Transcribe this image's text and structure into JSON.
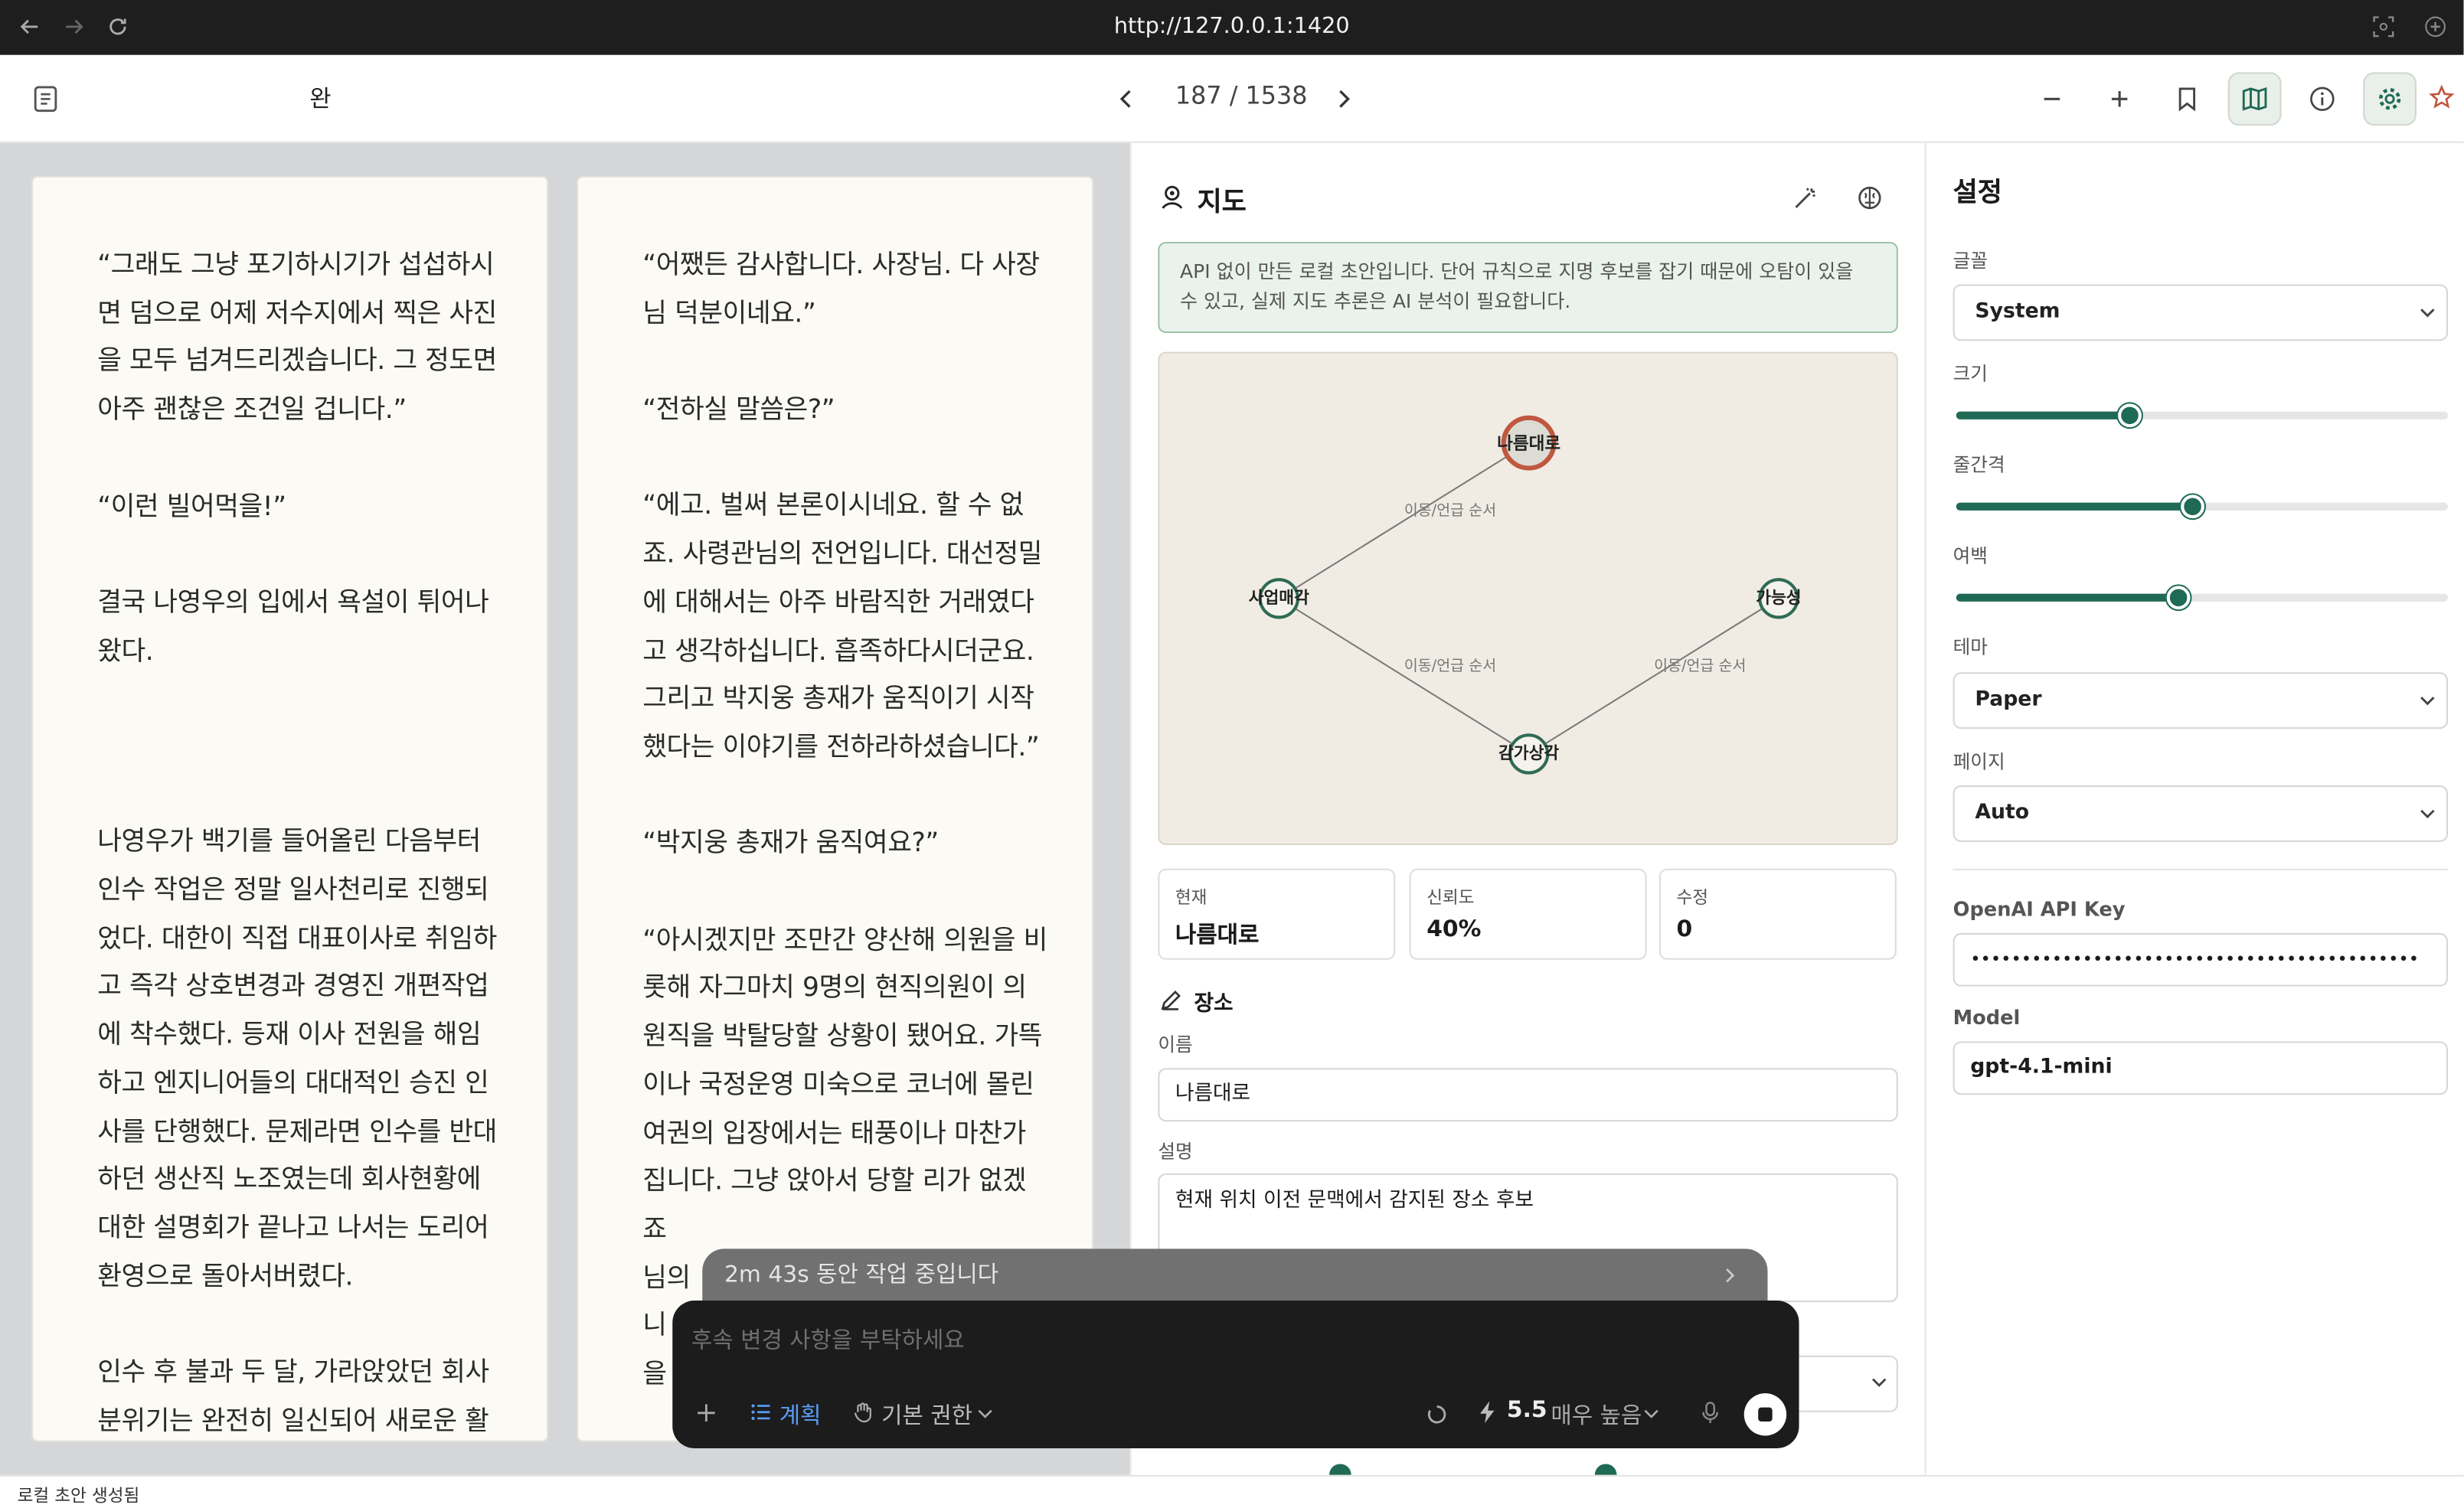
{
  "browser": {
    "url": "http://127.0.0.1:1420"
  },
  "toolbar": {
    "title": "완",
    "page_indicator": "187 / 1538"
  },
  "pages": [
    [
      "“그래도 그냥 포기하시기가 섭섭하시면 덤으로 어제 저수지에서 찍은 사진을 모두 넘겨드리겠습니다. 그 정도면 아주 괜찮은 조건일 겁니다.”",
      "“이런 빌어먹을!”",
      "결국 나영우의 입에서 욕설이 튀어나왔다.",
      "나영우가 백기를 들어올린 다음부터 인수 작업은 정말 일사천리로 진행되었다. 대한이 직접 대표이사로 취임하고 즉각 상호변경과 경영진 개편작업에 착수했다. 등재 이사 전원을 해임하고 엔지니어들의 대대적인 승진 인사를 단행했다. 문제라면 인수를 반대하던 생산직 노조였는데 회사현황에 대한 설명회가 끝나고 나서는 도리어 환영으로 돌아서버렸다.",
      "인수 후 불과 두 달, 가라앉았던 회사 분위기는 완전히 일신되어 새로운 활"
    ],
    [
      "“어쨌든 감사합니다. 사장님. 다 사장님 덕분이네요.”",
      "“전하실 말씀은?”",
      "“에고. 벌써 본론이시네요. 할 수 없죠. 사령관님의 전언입니다. 대선정밀에 대해서는 아주 바람직한 거래였다고 생각하십니다. 흡족하다시더군요. 그리고 박지웅 총재가 움직이기 시작했다는 이야기를 전하라하셨습니다.”",
      "“박지웅 총재가 움직여요?”",
      "“아시겠지만 조만간 양산해 의원을 비롯해 자그마치 9명의 현직의원이 의원직을 박탈당할 상황이 됐어요. 가뜩이나 국정운영 미숙으로 코너에 몰린 여권의 입장에서는 태풍이나 마찬가집니다. 그냥 앉아서 당할 리가 없겠죠",
      "님의",
      "니",
      "을"
    ]
  ],
  "map": {
    "heading": "지도",
    "notice": "API 없이 만든 로컬 초안입니다. 단어 규칙으로 지명 후보를 잡기 때문에 오탐이 있을 수 있고, 실제 지도 추론은 AI 분석이 필요합니다.",
    "nodes": [
      "나름대로",
      "사업매각",
      "가능성",
      "감가상각"
    ],
    "edge_label": "이동/언급 순서",
    "stats": [
      {
        "label": "현재",
        "value": "나름대로"
      },
      {
        "label": "신뢰도",
        "value": "40%"
      },
      {
        "label": "수정",
        "value": "0"
      }
    ],
    "place": {
      "heading": "장소",
      "name_label": "이름",
      "name_value": "나름대로",
      "desc_label": "설명",
      "desc_value": "현재 위치 이전 문맥에서 감지된 장소 후보"
    }
  },
  "settings": {
    "heading": "설정",
    "font_label": "글꼴",
    "font_value": "System",
    "size_label": "크기",
    "size_level": 0.35,
    "spacing_label": "줄간격",
    "spacing_level": 0.48,
    "margin_label": "여백",
    "margin_level": 0.45,
    "theme_label": "테마",
    "theme_value": "Paper",
    "page_label": "페이지",
    "page_value": "Auto",
    "api_label": "OpenAI API Key",
    "api_value": "••••••••••••••••••••••••••••••••••••••••••••",
    "model_label": "Model",
    "model_value": "gpt-4.1-mini"
  },
  "status": {
    "text": "로컬 초안 생성됨"
  },
  "agent": {
    "working": "2m 43s 동안 작업 중입니다",
    "placeholder": "후속 변경 사항을 부탁하세요",
    "plan": "계획",
    "permission": "기본 권한",
    "model": "5.5",
    "effort": "매우 높음"
  },
  "colors": {
    "accent": "#1f6a55",
    "node_active": "#c0573f",
    "node": "#2f6b55"
  }
}
